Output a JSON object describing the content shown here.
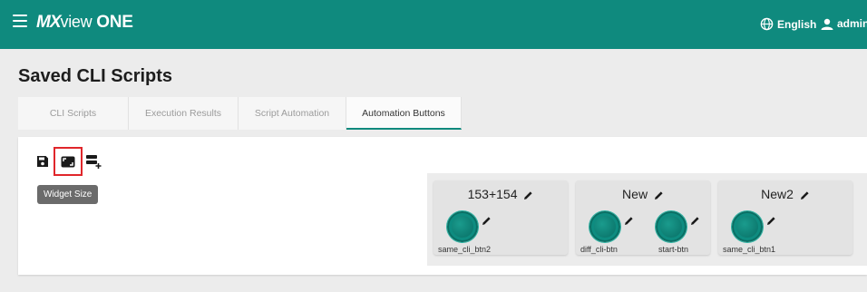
{
  "app": {
    "logo": {
      "mx": "MX",
      "view": "view",
      "one": "ONE"
    },
    "language": "English",
    "user": "admin"
  },
  "page": {
    "title": "Saved CLI Scripts"
  },
  "tabs": [
    {
      "label": "CLI Scripts",
      "active": false
    },
    {
      "label": "Execution Results",
      "active": false
    },
    {
      "label": "Script Automation",
      "active": false
    },
    {
      "label": "Automation Buttons",
      "active": true
    }
  ],
  "toolbar": {
    "icons": [
      "save-icon",
      "widget-size-icon",
      "add-widget-icon"
    ],
    "tooltip": "Widget Size"
  },
  "widgets": [
    {
      "title": "153+154",
      "buttons": [
        {
          "label": "same_cli_btn2"
        }
      ]
    },
    {
      "title": "New",
      "buttons": [
        {
          "label": "diff_cli-btn"
        },
        {
          "label": "start-btn"
        }
      ]
    },
    {
      "title": "New2",
      "buttons": [
        {
          "label": "same_cli_btn1"
        }
      ]
    }
  ],
  "colors": {
    "primary": "#0f8a7e",
    "highlight": "#e0262b"
  }
}
